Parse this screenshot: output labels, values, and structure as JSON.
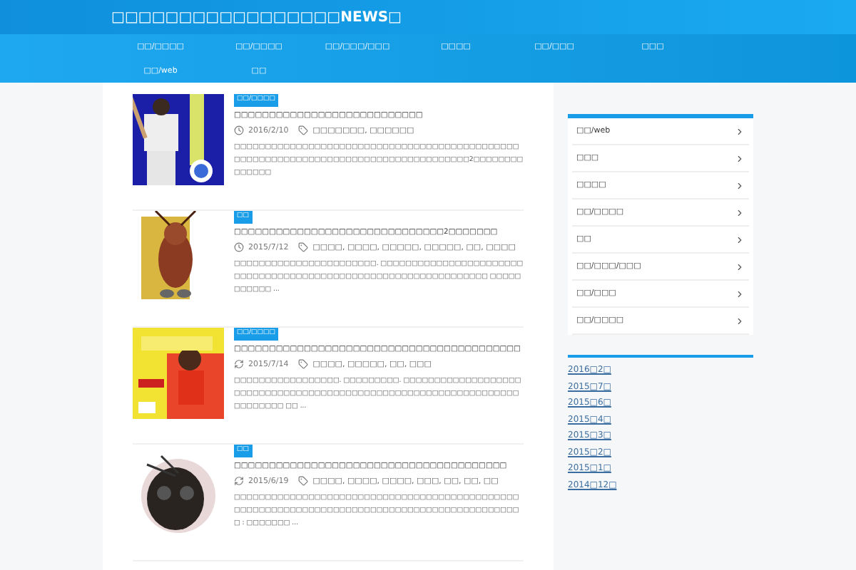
{
  "site_title": "□□□□□□□□□□□□□□□□□NEWS□",
  "nav": [
    {
      "label": "□□/□□□□"
    },
    {
      "label": "□□/□□□□"
    },
    {
      "label": "□□/□□□/□□□"
    },
    {
      "label": "□□□□"
    },
    {
      "label": "□□/□□□"
    },
    {
      "label": "□□□"
    },
    {
      "label": "□□/web"
    },
    {
      "label": "□□"
    }
  ],
  "posts": [
    {
      "category": "□□/□□□□",
      "title": "□□□□□□□□□□□□□□□□□□□□□□□□□□□",
      "updated": false,
      "date": "2016/2/10",
      "tags": "□□□□□□□, □□□□□□",
      "excerpt": "□□□□□□□□□□□□□□□□□□□□□□□□□□□□□□□□□□□□□□□□□□□□□□□□□□□□□□□□□□□□□□□□□□□□□□□□□□□□□□□□□□□□2□□□□□□□□□□□□□□"
    },
    {
      "category": "□□",
      "title": "□□□□□□□□□□□□□□□□□□□□□□□□□□□□□□2□□□□□□□",
      "updated": false,
      "date": "2015/7/12",
      "tags": "□□□□, □□□□, □□□□□, □□□□□, □□, □□□□",
      "excerpt": "□□□□□□□□□□□□□□□□□□□□□□□. □□□□□□□□□□□□□□□□□□□□□□□□□□□□□□□□□□□□□□□□□□□□□□□□□□□□□□□□□□□□□□□□ □□□□□□□□□□□ ..."
    },
    {
      "category": "□□/□□□□",
      "title": "□□□□□□□□□□□□□□□□□□□□□□□□□□□□□□□□□□□□□□□□□",
      "updated": true,
      "date": "2015/7/14",
      "tags": "□□□□, □□□□□, □□, □□□",
      "excerpt": "□□□□□□□□□□□□□□□□□. □□□□□□□□□. □□□□□□□□□□□□□□□□□□□□□□□□□□□□□□□□□□□□□□□□□□□□□□□□□□□□□□□□□□□□□□□□□□□□□□□□□ □□ ..."
    },
    {
      "category": "□□",
      "title": "□□□□□□□□□□□□□□□□□□□□□□□□□□□□□□□□□□□□□□□",
      "updated": true,
      "date": "2015/6/19",
      "tags": "□□□□, □□□□, □□□□, □□□, □□, □□, □□",
      "excerpt": "□□□□□□□□□□□□□□□□□□□□□□□□□□□□□□□□□□□□□□□□□□□□□□□□□□□□□□□□□□□□□□□□□□□□□□□□□□□□□□□□□□□□□□□□□□□□□ : □□□□□□□ ..."
    }
  ],
  "sidebar": {
    "categories": [
      {
        "label": "□□/web"
      },
      {
        "label": "□□□"
      },
      {
        "label": "□□□□"
      },
      {
        "label": "□□/□□□□"
      },
      {
        "label": "□□"
      },
      {
        "label": "□□/□□□/□□□"
      },
      {
        "label": "□□/□□□"
      },
      {
        "label": "□□/□□□□"
      }
    ],
    "archives": [
      {
        "label": "2016□2□"
      },
      {
        "label": "2015□7□"
      },
      {
        "label": "2015□6□"
      },
      {
        "label": "2015□4□"
      },
      {
        "label": "2015□3□"
      },
      {
        "label": "2015□2□"
      },
      {
        "label": "2015□1□"
      },
      {
        "label": "2014□12□"
      }
    ]
  }
}
